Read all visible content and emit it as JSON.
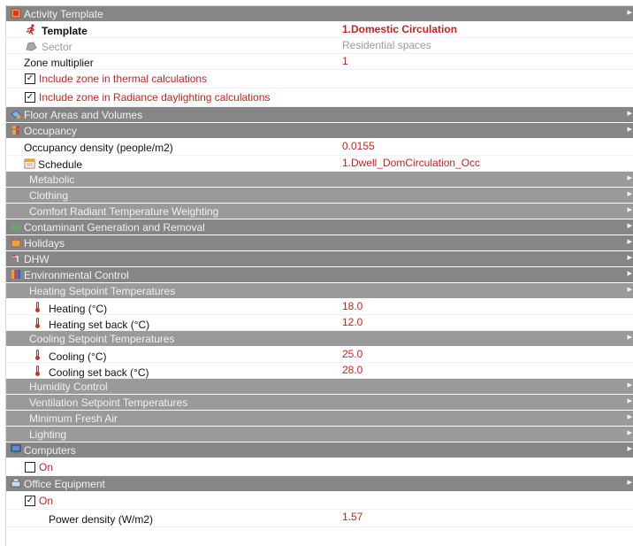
{
  "sections": {
    "activity_template": "Activity Template",
    "floor_areas": "Floor Areas and Volumes",
    "occupancy": "Occupancy",
    "metabolic": "Metabolic",
    "clothing": "Clothing",
    "comfort_radiant": "Comfort Radiant Temperature Weighting",
    "contaminant": "Contaminant Generation and Removal",
    "holidays": "Holidays",
    "dhw": "DHW",
    "environmental": "Environmental Control",
    "heating_setpoints": "Heating Setpoint Temperatures",
    "cooling_setpoints": "Cooling Setpoint Temperatures",
    "humidity": "Humidity Control",
    "ventilation_setpoints": "Ventilation Setpoint Temperatures",
    "min_fresh_air": "Minimum Fresh Air",
    "lighting": "Lighting",
    "computers": "Computers",
    "office_equipment": "Office Equipment"
  },
  "template": {
    "label": "Template",
    "value": "1.Domestic Circulation"
  },
  "sector": {
    "label": "Sector",
    "value": "Residential spaces"
  },
  "zone_multiplier": {
    "label": "Zone multiplier",
    "value": "1"
  },
  "include_thermal": {
    "label": "Include zone in thermal calculations",
    "checked": true
  },
  "include_radiance": {
    "label": "Include zone in Radiance daylighting calculations",
    "checked": true
  },
  "occupancy_density": {
    "label": "Occupancy density (people/m2)",
    "value": "0.0155"
  },
  "schedule": {
    "label": "Schedule",
    "value": "1.Dwell_DomCirculation_Occ"
  },
  "heating": {
    "label": "Heating (°C)",
    "value": "18.0"
  },
  "heating_setback": {
    "label": "Heating set back (°C)",
    "value": "12.0"
  },
  "cooling": {
    "label": "Cooling (°C)",
    "value": "25.0"
  },
  "cooling_setback": {
    "label": "Cooling set back (°C)",
    "value": "28.0"
  },
  "computers_on": {
    "label": "On",
    "checked": false
  },
  "office_on": {
    "label": "On",
    "checked": true
  },
  "power_density": {
    "label": "Power density (W/m2)",
    "value": "1.57"
  },
  "check_mark": "✓",
  "collapse_arrow": "▸",
  "colors": {
    "header": "#868686",
    "subheader": "#9a9a9a",
    "accent_red": "#cf1f1f"
  }
}
